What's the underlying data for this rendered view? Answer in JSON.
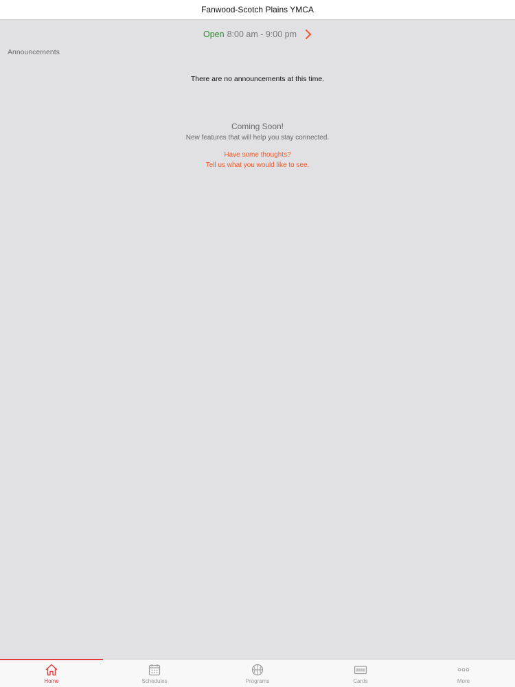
{
  "header": {
    "title": "Fanwood-Scotch Plains YMCA"
  },
  "hours": {
    "status": "Open",
    "time_range": "8:00 am - 9:00 pm",
    "status_color": "#2e8b2e"
  },
  "announcements": {
    "section_label": "Announcements",
    "empty_message": "There are no announcements at this time."
  },
  "coming_soon": {
    "title": "Coming Soon!",
    "subtitle": "New features that will help you stay connected.",
    "feedback_line1": "Have some thoughts?",
    "feedback_line2": "Tell us what you would like to see."
  },
  "tabbar": {
    "tabs": [
      {
        "label": "Home",
        "icon": "home-icon",
        "active": true
      },
      {
        "label": "Schedules",
        "icon": "calendar-icon",
        "active": false
      },
      {
        "label": "Programs",
        "icon": "basketball-icon",
        "active": false
      },
      {
        "label": "Cards",
        "icon": "card-icon",
        "active": false
      },
      {
        "label": "More",
        "icon": "more-icon",
        "active": false
      }
    ]
  },
  "colors": {
    "accent": "#e4393b",
    "link": "#ef5a2a",
    "background": "#e1e0e2"
  }
}
